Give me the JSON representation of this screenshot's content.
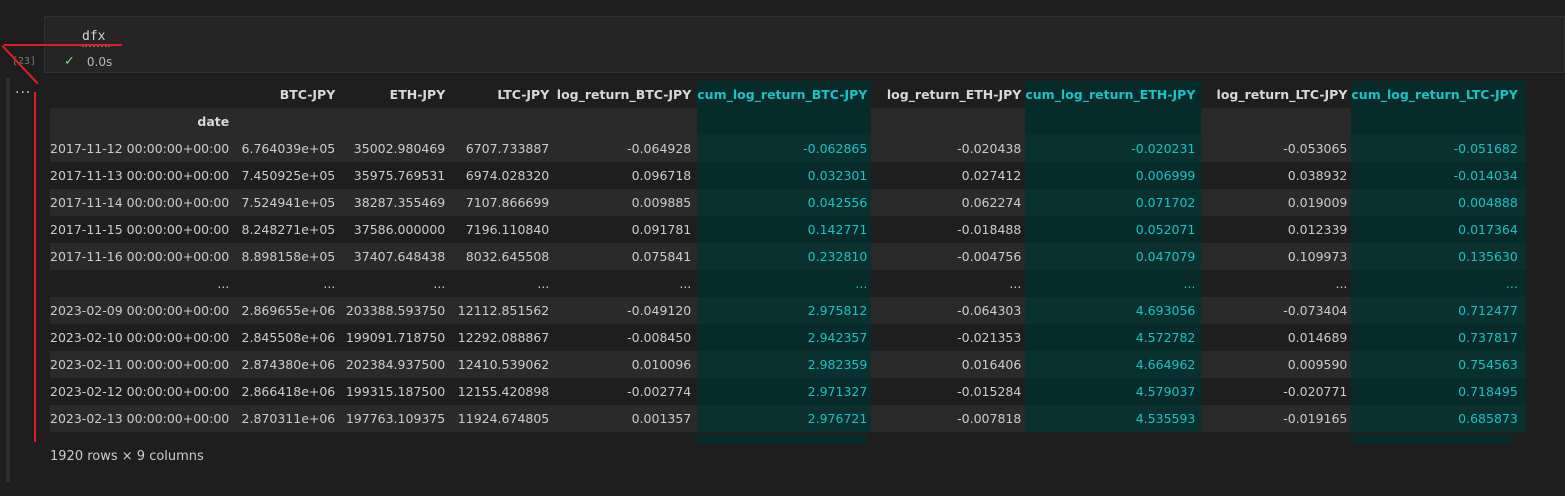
{
  "cell": {
    "code": "dfx",
    "exec_count": "[23]",
    "status_time": "0.0s",
    "output_menu": "..."
  },
  "table": {
    "index_name": "date",
    "columns": [
      "BTC-JPY",
      "ETH-JPY",
      "LTC-JPY",
      "log_return_BTC-JPY",
      "cum_log_return_BTC-JPY",
      "log_return_ETH-JPY",
      "cum_log_return_ETH-JPY",
      "log_return_LTC-JPY",
      "cum_log_return_LTC-JPY"
    ],
    "rows": [
      [
        "2017-11-12 00:00:00+00:00",
        "6.764039e+05",
        "35002.980469",
        "6707.733887",
        "-0.064928",
        "-0.062865",
        "-0.020438",
        "-0.020231",
        "-0.053065",
        "-0.051682"
      ],
      [
        "2017-11-13 00:00:00+00:00",
        "7.450925e+05",
        "35975.769531",
        "6974.028320",
        "0.096718",
        "0.032301",
        "0.027412",
        "0.006999",
        "0.038932",
        "-0.014034"
      ],
      [
        "2017-11-14 00:00:00+00:00",
        "7.524941e+05",
        "38287.355469",
        "7107.866699",
        "0.009885",
        "0.042556",
        "0.062274",
        "0.071702",
        "0.019009",
        "0.004888"
      ],
      [
        "2017-11-15 00:00:00+00:00",
        "8.248271e+05",
        "37586.000000",
        "7196.110840",
        "0.091781",
        "0.142771",
        "-0.018488",
        "0.052071",
        "0.012339",
        "0.017364"
      ],
      [
        "2017-11-16 00:00:00+00:00",
        "8.898158e+05",
        "37407.648438",
        "8032.645508",
        "0.075841",
        "0.232810",
        "-0.004756",
        "0.047079",
        "0.109973",
        "0.135630"
      ],
      [
        "...",
        "...",
        "...",
        "...",
        "...",
        "...",
        "...",
        "...",
        "...",
        "..."
      ],
      [
        "2023-02-09 00:00:00+00:00",
        "2.869655e+06",
        "203388.593750",
        "12112.851562",
        "-0.049120",
        "2.975812",
        "-0.064303",
        "4.693056",
        "-0.073404",
        "0.712477"
      ],
      [
        "2023-02-10 00:00:00+00:00",
        "2.845508e+06",
        "199091.718750",
        "12292.088867",
        "-0.008450",
        "2.942357",
        "-0.021353",
        "4.572782",
        "0.014689",
        "0.737817"
      ],
      [
        "2023-02-11 00:00:00+00:00",
        "2.874380e+06",
        "202384.937500",
        "12410.539062",
        "0.010096",
        "2.982359",
        "0.016406",
        "4.664962",
        "0.009590",
        "0.754563"
      ],
      [
        "2023-02-12 00:00:00+00:00",
        "2.866418e+06",
        "199315.187500",
        "12155.420898",
        "-0.002774",
        "2.971327",
        "-0.015284",
        "4.579037",
        "-0.020771",
        "0.718495"
      ],
      [
        "2023-02-13 00:00:00+00:00",
        "2.870311e+06",
        "197763.109375",
        "11924.674805",
        "0.001357",
        "2.976721",
        "-0.007818",
        "4.535593",
        "-0.019165",
        "0.685873"
      ]
    ],
    "highlight_color": "#19c3c3",
    "highlight_bg": "#072a2a"
  },
  "footer": {
    "shape": "1920 rows × 9 columns"
  }
}
